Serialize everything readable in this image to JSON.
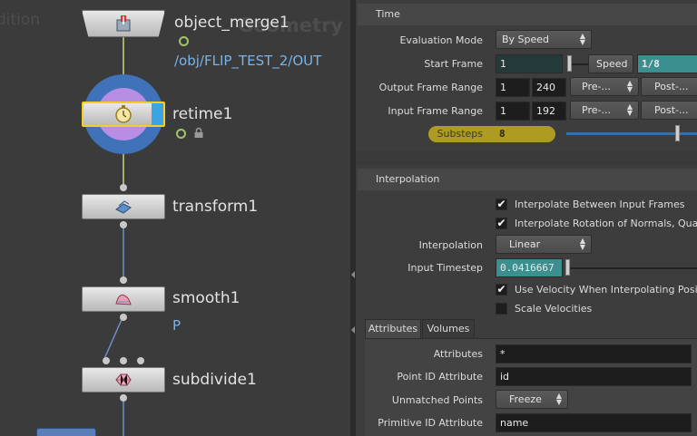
{
  "network": {
    "ghost_left": "dition",
    "ghost_right": "Geometry",
    "nodes": [
      {
        "id": "object_merge",
        "name": "object_merge1",
        "sub": "/obj/FLIP_TEST_2/OUT",
        "icon": "object-merge-icon"
      },
      {
        "id": "retime",
        "name": "retime1",
        "icon": "stopwatch-icon"
      },
      {
        "id": "transform",
        "name": "transform1",
        "icon": "transform-icon"
      },
      {
        "id": "smooth",
        "name": "smooth1",
        "sub": "P",
        "icon": "smooth-icon"
      },
      {
        "id": "subdivide",
        "name": "subdivide1",
        "icon": "subdivide-icon"
      }
    ],
    "colors": {
      "wire_green": "#c3d77a",
      "wire_blue": "#6b8fc7",
      "selected_outline": "#f0d020",
      "display_flag": "#3ba3e6"
    }
  },
  "params": {
    "time_section": "Time",
    "evaluation_mode": {
      "label": "Evaluation Mode",
      "value": "By Speed"
    },
    "start_frame": {
      "label": "Start Frame",
      "value": "1",
      "speed_btn": "Speed",
      "speed_value": "1/8"
    },
    "output_range": {
      "label": "Output Frame Range",
      "start": "1",
      "end": "240",
      "pre": "Pre-...",
      "post": "Post-..."
    },
    "input_range": {
      "label": "Input Frame Range",
      "start": "1",
      "end": "192",
      "pre": "Pre-...",
      "post": "Post-..."
    },
    "substeps": {
      "label": "Substeps",
      "value": "8"
    },
    "interp_section": "Interpolation",
    "interp_between": "Interpolate Between Input Frames",
    "interp_rotation": "Interpolate Rotation of Normals, Quaterni",
    "interpolation": {
      "label": "Interpolation",
      "value": "Linear"
    },
    "input_timestep": {
      "label": "Input Timestep",
      "value": "0.0416667"
    },
    "use_velocity": "Use Velocity When Interpolating Position",
    "scale_velocities": "Scale Velocities",
    "tabs": [
      "Attributes",
      "Volumes"
    ],
    "attributes": {
      "label": "Attributes",
      "value": "*"
    },
    "point_id": {
      "label": "Point ID Attribute",
      "value": "id"
    },
    "unmatched": {
      "label": "Unmatched Points",
      "value": "Freeze"
    },
    "prim_id": {
      "label": "Primitive ID Attribute",
      "value": "name"
    }
  }
}
